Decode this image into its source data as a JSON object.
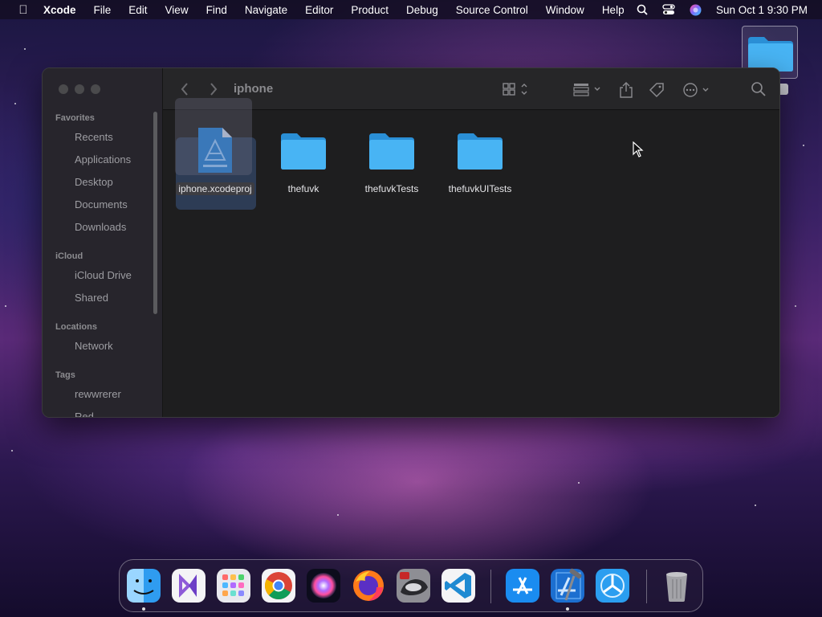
{
  "menubar": {
    "app_name": "Xcode",
    "items": [
      "File",
      "Edit",
      "View",
      "Find",
      "Navigate",
      "Editor",
      "Product",
      "Debug",
      "Source Control",
      "Window",
      "Help"
    ],
    "clock": "Sun Oct 1  9:30 PM",
    "status_icons": [
      "search-icon",
      "control-center-icon",
      "siri-icon"
    ]
  },
  "finder": {
    "title": "iphone",
    "sidebar": {
      "favorites_header": "Favorites",
      "favorites": [
        "Recents",
        "Applications",
        "Desktop",
        "Documents",
        "Downloads"
      ],
      "icloud_header": "iCloud",
      "icloud": [
        "iCloud Drive",
        "Shared"
      ],
      "locations_header": "Locations",
      "locations": [
        "Network"
      ],
      "tags_header": "Tags",
      "tags": [
        "rewwrerer",
        "Red"
      ]
    },
    "toolbar_icons": [
      "back-icon",
      "forward-icon",
      "view-mode-icon",
      "group-icon",
      "share-icon",
      "tag-icon",
      "more-icon",
      "search-icon"
    ],
    "files": [
      {
        "name": "iphone.xcodeproj",
        "kind": "xcode-project",
        "selected": true
      },
      {
        "name": "thefuvk",
        "kind": "folder",
        "selected": false
      },
      {
        "name": "thefuvkTests",
        "kind": "folder",
        "selected": false
      },
      {
        "name": "thefuvkUITests",
        "kind": "folder",
        "selected": false
      }
    ]
  },
  "desktop": {
    "items": [
      {
        "kind": "folder",
        "selected": true
      }
    ]
  },
  "dock": {
    "apps": [
      "finder",
      "visual-studio",
      "launchpad",
      "chrome",
      "siri",
      "firefox",
      "quicktime",
      "vscode",
      "app-store",
      "xcode",
      "instruments",
      "trash"
    ],
    "accent_colors": {
      "folder": "#3aaaf0",
      "selection": "#3a5682"
    }
  }
}
